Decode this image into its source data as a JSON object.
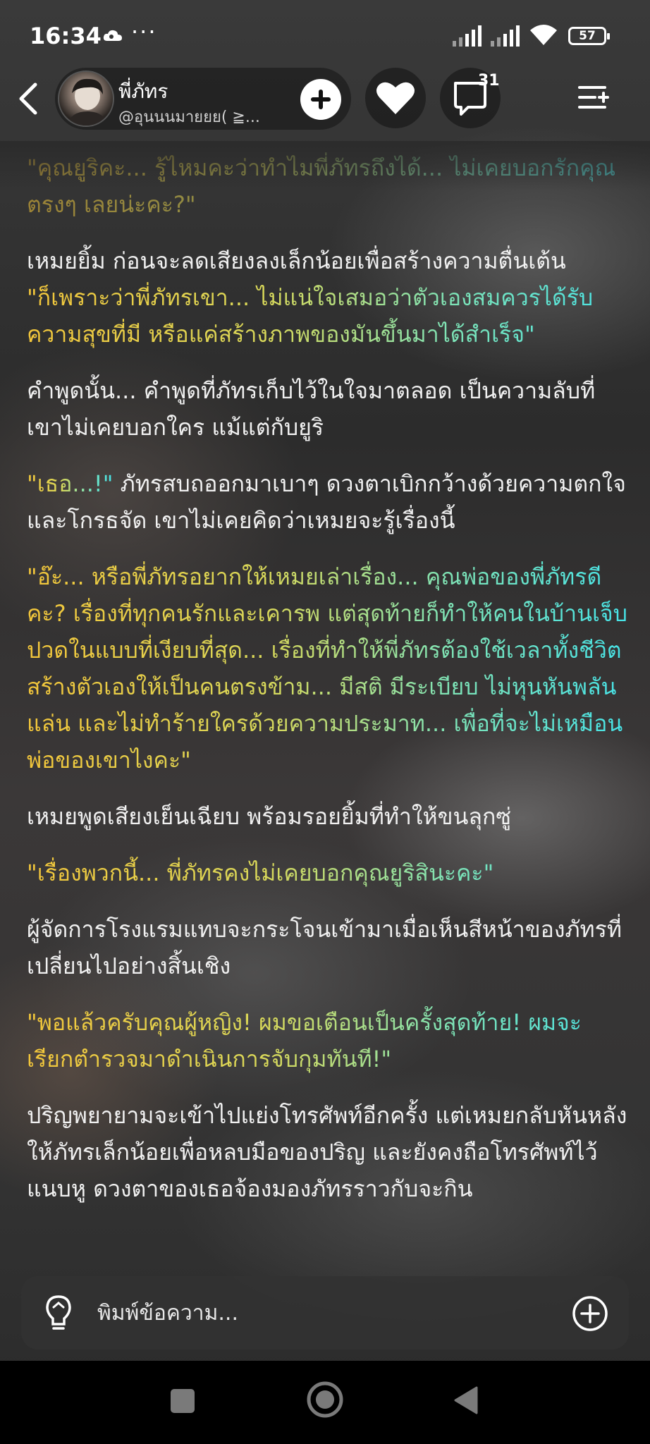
{
  "status_bar": {
    "time": "16:34",
    "dots": "···",
    "battery": "57"
  },
  "header": {
    "author_name": "พี่ภัทร",
    "author_handle": "@อุนนนมายยย( ≧...",
    "comment_count": "31"
  },
  "story": {
    "paragraphs": [
      {
        "type": "dialogue",
        "text": "\"คุณยูริคะ... รู้ไหมคะว่าทำไมพี่ภัทรถึงได้... ไม่เคยบอกรักคุณตรงๆ เลยน่ะคะ?\""
      },
      {
        "type": "narration",
        "text": "เหมยยิ้ม ก่อนจะลดเสียงลงเล็กน้อยเพื่อสร้างความตื่นเต้น"
      },
      {
        "type": "dialogue",
        "text": "\"ก็เพราะว่าพี่ภัทรเขา... ไม่แน่ใจเสมอว่าตัวเองสมควรได้รับความสุขที่มี หรือแค่สร้างภาพของมันขึ้นมาได้สำเร็จ\""
      },
      {
        "type": "narration",
        "text": "คำพูดนั้น... คำพูดที่ภัทรเก็บไว้ในใจมาตลอด เป็นความลับที่เขาไม่เคยบอกใคร แม้แต่กับยูริ"
      },
      {
        "type": "mixed",
        "dialogue": "\"เธอ...!\"",
        "text": " ภัทรสบถออกมาเบาๆ ดวงตาเบิกกว้างด้วยความตกใจและโกรธจัด เขาไม่เคยคิดว่าเหมยจะรู้เรื่องนี้"
      },
      {
        "type": "dialogue",
        "text": "\"อ๊ะ... หรือพี่ภัทรอยากให้เหมยเล่าเรื่อง... คุณพ่อของพี่ภัทรดีคะ? เรื่องที่ทุกคนรักและเคารพ แต่สุดท้ายก็ทำให้คนในบ้านเจ็บปวดในแบบที่เงียบที่สุด... เรื่องที่ทำให้พี่ภัทรต้องใช้เวลาทั้งชีวิตสร้างตัวเองให้เป็นคนตรงข้าม... มีสติ มีระเบียบ ไม่หุนหันพลันแล่น และไม่ทำร้ายใครด้วยความประมาท... เพื่อที่จะไม่เหมือนพ่อของเขาไงคะ\""
      },
      {
        "type": "narration",
        "text": "เหมยพูดเสียงเย็นเฉียบ พร้อมรอยยิ้มที่ทำให้ขนลุกซู่"
      },
      {
        "type": "dialogue",
        "text": "\"เรื่องพวกนี้... พี่ภัทรคงไม่เคยบอกคุณยูริสินะคะ\""
      },
      {
        "type": "narration",
        "text": "ผู้จัดการโรงแรมแทบจะกระโจนเข้ามาเมื่อเห็นสีหน้าของภัทรที่เปลี่ยนไปอย่างสิ้นเชิง"
      },
      {
        "type": "dialogue",
        "text": "\"พอแล้วครับคุณผู้หญิง! ผมขอเตือนเป็นครั้งสุดท้าย! ผมจะเรียกตำรวจมาดำเนินการจับกุมทันที!\""
      },
      {
        "type": "narration",
        "text": "ปริญพยายามจะเข้าไปแย่งโทรศัพท์อีกครั้ง แต่เหมยกลับหันหลังให้ภัทรเล็กน้อยเพื่อหลบมือของปริญ และยังคงถือโทรศัพท์ไว้แนบหู ดวงตาของเธอจ้องมองภัทรราวกับจะกิน"
      }
    ]
  },
  "input_bar": {
    "placeholder": "พิมพ์ข้อความ..."
  },
  "colors": {
    "dialogue_start": "#f3c63a",
    "dialogue_end": "#46e3e8",
    "narration": "#f0f0f0"
  }
}
